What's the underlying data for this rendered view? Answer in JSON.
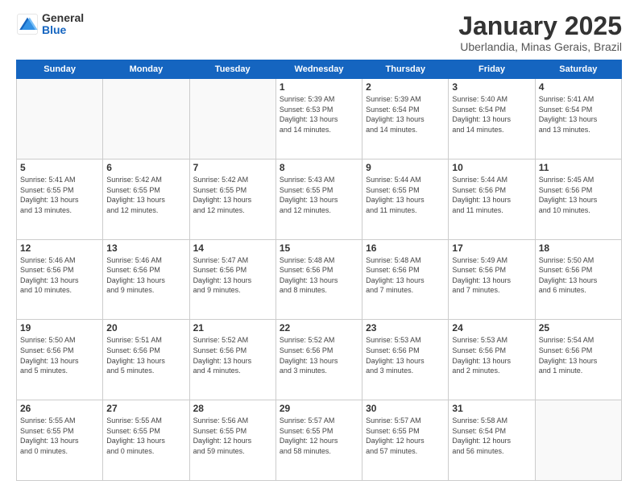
{
  "logo": {
    "general": "General",
    "blue": "Blue"
  },
  "header": {
    "month": "January 2025",
    "location": "Uberlandia, Minas Gerais, Brazil"
  },
  "weekdays": [
    "Sunday",
    "Monday",
    "Tuesday",
    "Wednesday",
    "Thursday",
    "Friday",
    "Saturday"
  ],
  "weeks": [
    [
      {
        "day": "",
        "info": ""
      },
      {
        "day": "",
        "info": ""
      },
      {
        "day": "",
        "info": ""
      },
      {
        "day": "1",
        "info": "Sunrise: 5:39 AM\nSunset: 6:53 PM\nDaylight: 13 hours\nand 14 minutes."
      },
      {
        "day": "2",
        "info": "Sunrise: 5:39 AM\nSunset: 6:54 PM\nDaylight: 13 hours\nand 14 minutes."
      },
      {
        "day": "3",
        "info": "Sunrise: 5:40 AM\nSunset: 6:54 PM\nDaylight: 13 hours\nand 14 minutes."
      },
      {
        "day": "4",
        "info": "Sunrise: 5:41 AM\nSunset: 6:54 PM\nDaylight: 13 hours\nand 13 minutes."
      }
    ],
    [
      {
        "day": "5",
        "info": "Sunrise: 5:41 AM\nSunset: 6:55 PM\nDaylight: 13 hours\nand 13 minutes."
      },
      {
        "day": "6",
        "info": "Sunrise: 5:42 AM\nSunset: 6:55 PM\nDaylight: 13 hours\nand 12 minutes."
      },
      {
        "day": "7",
        "info": "Sunrise: 5:42 AM\nSunset: 6:55 PM\nDaylight: 13 hours\nand 12 minutes."
      },
      {
        "day": "8",
        "info": "Sunrise: 5:43 AM\nSunset: 6:55 PM\nDaylight: 13 hours\nand 12 minutes."
      },
      {
        "day": "9",
        "info": "Sunrise: 5:44 AM\nSunset: 6:55 PM\nDaylight: 13 hours\nand 11 minutes."
      },
      {
        "day": "10",
        "info": "Sunrise: 5:44 AM\nSunset: 6:56 PM\nDaylight: 13 hours\nand 11 minutes."
      },
      {
        "day": "11",
        "info": "Sunrise: 5:45 AM\nSunset: 6:56 PM\nDaylight: 13 hours\nand 10 minutes."
      }
    ],
    [
      {
        "day": "12",
        "info": "Sunrise: 5:46 AM\nSunset: 6:56 PM\nDaylight: 13 hours\nand 10 minutes."
      },
      {
        "day": "13",
        "info": "Sunrise: 5:46 AM\nSunset: 6:56 PM\nDaylight: 13 hours\nand 9 minutes."
      },
      {
        "day": "14",
        "info": "Sunrise: 5:47 AM\nSunset: 6:56 PM\nDaylight: 13 hours\nand 9 minutes."
      },
      {
        "day": "15",
        "info": "Sunrise: 5:48 AM\nSunset: 6:56 PM\nDaylight: 13 hours\nand 8 minutes."
      },
      {
        "day": "16",
        "info": "Sunrise: 5:48 AM\nSunset: 6:56 PM\nDaylight: 13 hours\nand 7 minutes."
      },
      {
        "day": "17",
        "info": "Sunrise: 5:49 AM\nSunset: 6:56 PM\nDaylight: 13 hours\nand 7 minutes."
      },
      {
        "day": "18",
        "info": "Sunrise: 5:50 AM\nSunset: 6:56 PM\nDaylight: 13 hours\nand 6 minutes."
      }
    ],
    [
      {
        "day": "19",
        "info": "Sunrise: 5:50 AM\nSunset: 6:56 PM\nDaylight: 13 hours\nand 5 minutes."
      },
      {
        "day": "20",
        "info": "Sunrise: 5:51 AM\nSunset: 6:56 PM\nDaylight: 13 hours\nand 5 minutes."
      },
      {
        "day": "21",
        "info": "Sunrise: 5:52 AM\nSunset: 6:56 PM\nDaylight: 13 hours\nand 4 minutes."
      },
      {
        "day": "22",
        "info": "Sunrise: 5:52 AM\nSunset: 6:56 PM\nDaylight: 13 hours\nand 3 minutes."
      },
      {
        "day": "23",
        "info": "Sunrise: 5:53 AM\nSunset: 6:56 PM\nDaylight: 13 hours\nand 3 minutes."
      },
      {
        "day": "24",
        "info": "Sunrise: 5:53 AM\nSunset: 6:56 PM\nDaylight: 13 hours\nand 2 minutes."
      },
      {
        "day": "25",
        "info": "Sunrise: 5:54 AM\nSunset: 6:56 PM\nDaylight: 13 hours\nand 1 minute."
      }
    ],
    [
      {
        "day": "26",
        "info": "Sunrise: 5:55 AM\nSunset: 6:55 PM\nDaylight: 13 hours\nand 0 minutes."
      },
      {
        "day": "27",
        "info": "Sunrise: 5:55 AM\nSunset: 6:55 PM\nDaylight: 13 hours\nand 0 minutes."
      },
      {
        "day": "28",
        "info": "Sunrise: 5:56 AM\nSunset: 6:55 PM\nDaylight: 12 hours\nand 59 minutes."
      },
      {
        "day": "29",
        "info": "Sunrise: 5:57 AM\nSunset: 6:55 PM\nDaylight: 12 hours\nand 58 minutes."
      },
      {
        "day": "30",
        "info": "Sunrise: 5:57 AM\nSunset: 6:55 PM\nDaylight: 12 hours\nand 57 minutes."
      },
      {
        "day": "31",
        "info": "Sunrise: 5:58 AM\nSunset: 6:54 PM\nDaylight: 12 hours\nand 56 minutes."
      },
      {
        "day": "",
        "info": ""
      }
    ]
  ]
}
